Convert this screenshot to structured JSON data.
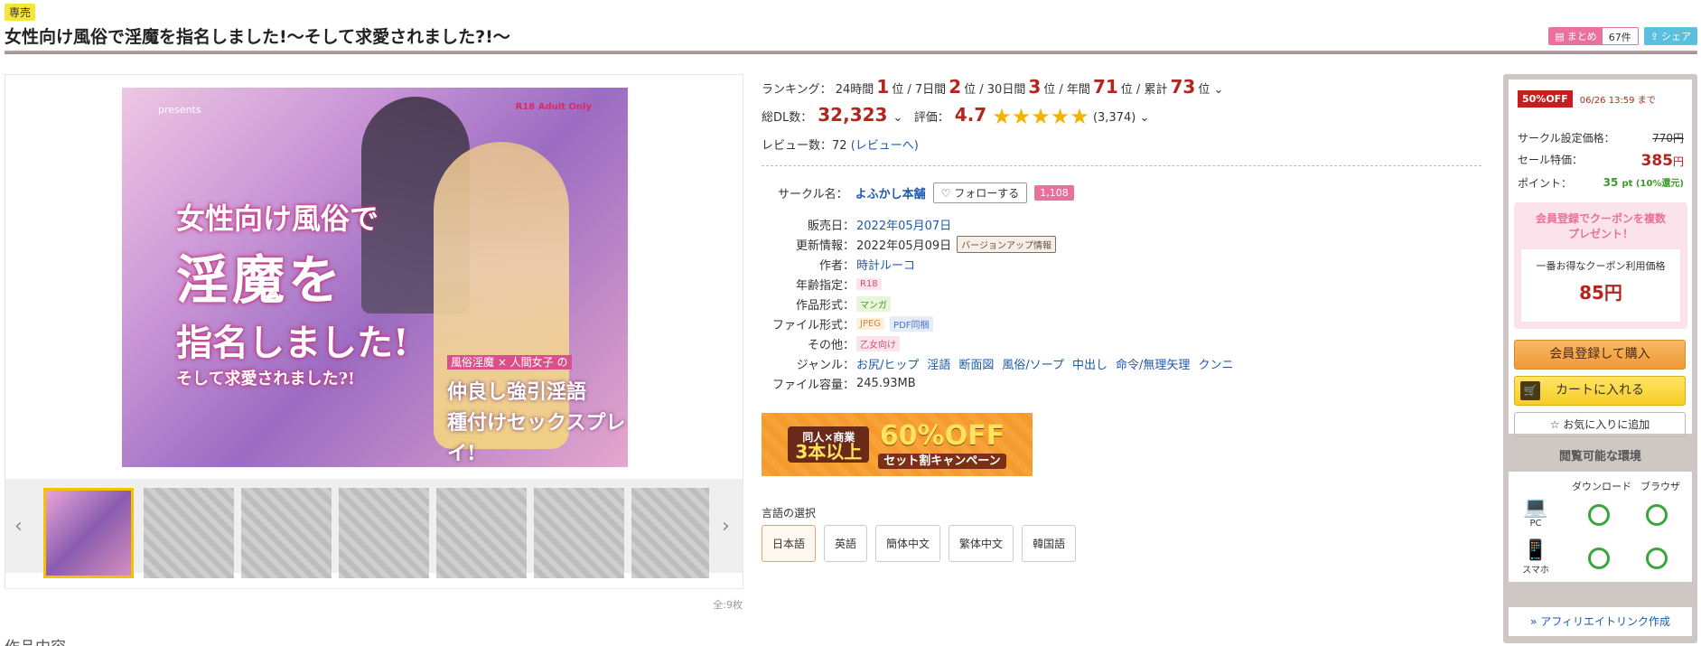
{
  "header": {
    "exclusive_badge": "専売",
    "title": "女性向け風俗で淫魔を指名しました!〜そして求愛されました?!〜",
    "matome_label": "まとめ",
    "matome_count": "67件",
    "share_label": "シェア"
  },
  "gallery": {
    "cover": {
      "presents": "presents",
      "r18_mark": "R18 Adult Only",
      "title_line1": "女性向け風俗で",
      "title_line2": "淫魔を",
      "title_line3": "指名しました!",
      "title_line4": "そして求愛されました?!",
      "tag_top": "風俗淫魔 × 人間女子 の",
      "tagline1": "仲良し強引淫語",
      "tagline2": "種付けセックスプレイ!"
    },
    "thumb_count": 7,
    "total": "全:9枚"
  },
  "ranking": {
    "label": "ランキング：",
    "items": [
      {
        "period": "24時間",
        "rank": "1",
        "unit": "位"
      },
      {
        "period": "7日間",
        "rank": "2",
        "unit": "位"
      },
      {
        "period": "30日間",
        "rank": "3",
        "unit": "位"
      },
      {
        "period": "年間",
        "rank": "71",
        "unit": "位"
      },
      {
        "period": "累計",
        "rank": "73",
        "unit": "位"
      }
    ]
  },
  "stats": {
    "dl_label": "総DL数：",
    "dl_count": "32,323",
    "rating_label": "評価：",
    "rating": "4.7",
    "rating_stars": 4.7,
    "rating_count": "(3,374)",
    "review_label": "レビュー数：",
    "review_count": "72",
    "review_link": "(レビューへ)"
  },
  "circle": {
    "label": "サークル名：",
    "name": "よふかし本舗",
    "follow": "フォローする",
    "followers": "1,108"
  },
  "spec": {
    "release_label": "販売日：",
    "release": "2022年05月07日",
    "update_label": "更新情報：",
    "update": "2022年05月09日",
    "update_tag": "バージョンアップ情報",
    "author_label": "作者：",
    "author": "時計ルーコ",
    "age_label": "年齢指定：",
    "age": "R18",
    "format_label": "作品形式：",
    "format": "マンガ",
    "file_label": "ファイル形式：",
    "file1": "JPEG",
    "file2": "PDF同梱",
    "other_label": "その他：",
    "other": "乙女向け",
    "genre_label": "ジャンル：",
    "genres": [
      "お尻/ヒップ",
      "淫語",
      "断面図",
      "風俗/ソープ",
      "中出し",
      "命令/無理矢理",
      "クンニ"
    ],
    "size_label": "ファイル容量：",
    "size": "245.93MB"
  },
  "banner": {
    "left_top": "同人×商業",
    "left_big": "3本以上",
    "right_big": "60%OFF",
    "right_small": "セット割キャンペーン"
  },
  "language": {
    "label": "言語の選択",
    "options": [
      "日本語",
      "英語",
      "簡体中文",
      "繁体中文",
      "韓国語"
    ],
    "selected": "日本語"
  },
  "purchase": {
    "off_badge": "50%OFF",
    "off_deadline": "06/26 13:59 まで",
    "set_price_label": "サークル設定価格：",
    "set_price": "770円",
    "sale_label": "セール特価：",
    "sale_price": "385",
    "sale_unit": "円",
    "point_label": "ポイント：",
    "point": "35",
    "point_unit": "pt (10%還元)",
    "coupon_title1": "会員登録でクーポンを複数",
    "coupon_title2": "プレゼント！",
    "coupon_sub": "一番お得なクーポン利用価格",
    "coupon_price": "85円",
    "buy_button": "会員登録して購入",
    "cart_button": "カートに入れる",
    "fav_button": "お気に入りに追加",
    "env_title": "閲覧可能な環境",
    "env_dl": "ダウンロード",
    "env_browser": "ブラウザ",
    "env_pc": "PC",
    "env_phone": "スマホ",
    "affiliate": "アフィリエイトリンク作成"
  },
  "content_heading": "作品内容",
  "colors": {
    "accent_red": "#b3261e",
    "star": "#f2b400",
    "pink": "#e9719b",
    "link": "#1e5aa8"
  }
}
